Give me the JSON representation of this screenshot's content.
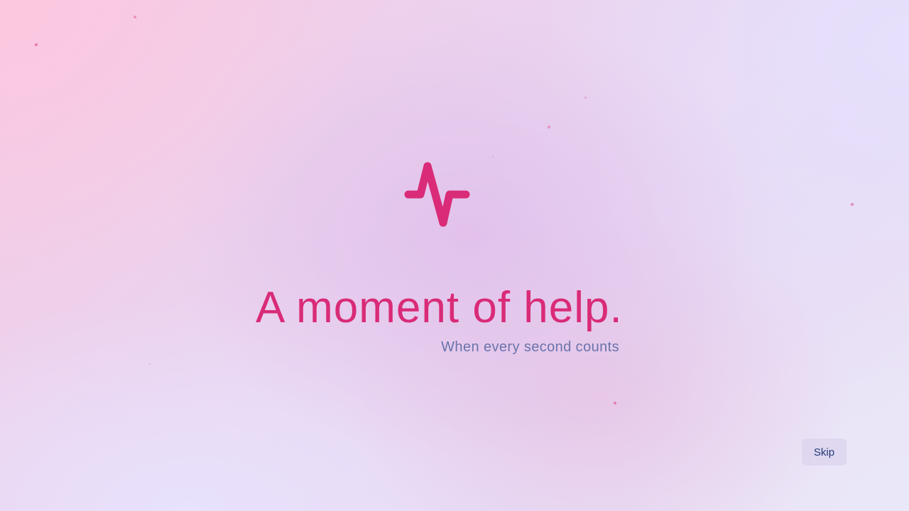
{
  "splash": {
    "logo_icon": "pulse-heartbeat-icon",
    "headline": "A moment of help.",
    "tagline": "When every second counts",
    "skip_label": "Skip"
  },
  "colors": {
    "accent": "#d92b77",
    "tagline": "#6a74ab",
    "skip_text": "#243a78",
    "skip_bg": "#ded6ee",
    "particles": "#e26aa6"
  }
}
